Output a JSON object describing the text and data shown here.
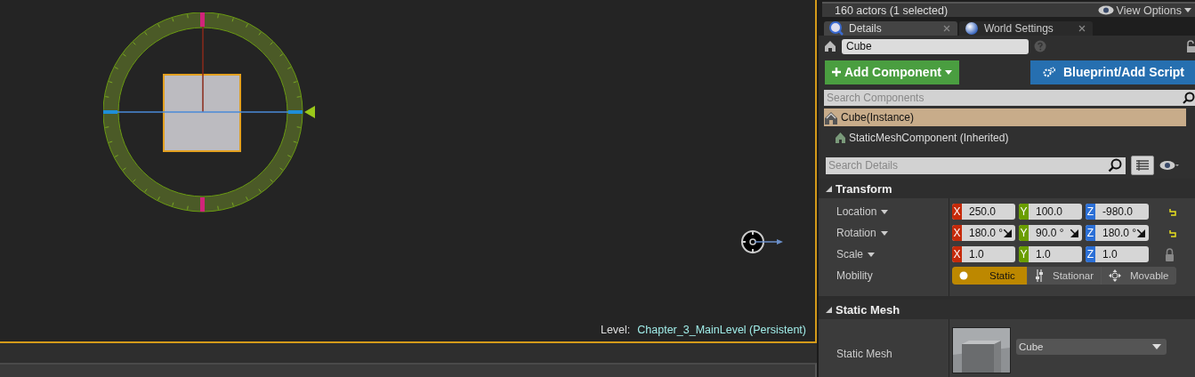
{
  "viewport": {
    "level_label": "Level:",
    "level_name": "Chapter_3_MainLevel (Persistent)"
  },
  "outliner": {
    "actor_count": "160 actors (1 selected)",
    "view_options": "View Options"
  },
  "tabs": [
    {
      "label": "Details",
      "selected": true,
      "kind": "details"
    },
    {
      "label": "World Settings",
      "selected": false,
      "kind": "world"
    }
  ],
  "actor_name": "Cube",
  "add_component": "Add Component",
  "blueprint": "Blueprint/Add Script",
  "component_search": {
    "placeholder": "Search Components"
  },
  "components": [
    {
      "label": "Cube(Instance)",
      "selected": true,
      "children": [
        {
          "label": "StaticMeshComponent (Inherited)",
          "selected": false
        }
      ]
    }
  ],
  "details_search": {
    "placeholder": "Search Details"
  },
  "sections": [
    {
      "title": "Transform",
      "expanded": true,
      "rows": [
        {
          "label": "Location",
          "kind": "vector",
          "dropdown": true,
          "reset": true,
          "values": [
            {
              "axis": "X",
              "value": "250.0"
            },
            {
              "axis": "Y",
              "value": "100.0"
            },
            {
              "axis": "Z",
              "value": "-980.0"
            }
          ]
        },
        {
          "label": "Rotation",
          "kind": "vector",
          "dropdown": true,
          "reset": true,
          "spin": true,
          "values": [
            {
              "axis": "X",
              "value": "180.0 °"
            },
            {
              "axis": "Y",
              "value": "90.0 °"
            },
            {
              "axis": "Z",
              "value": "180.0 °"
            }
          ]
        },
        {
          "label": "Scale",
          "kind": "vector",
          "dropdown": true,
          "lock": true,
          "values": [
            {
              "axis": "X",
              "value": "1.0"
            },
            {
              "axis": "Y",
              "value": "1.0"
            },
            {
              "axis": "Z",
              "value": "1.0"
            }
          ]
        },
        {
          "label": "Mobility",
          "kind": "mobility",
          "dropdown": false,
          "options": [
            {
              "label": "Static",
              "selected": true
            },
            {
              "label": "Stationar",
              "selected": false
            },
            {
              "label": "Movable",
              "selected": false
            }
          ]
        }
      ]
    },
    {
      "title": "Static Mesh",
      "expanded": true,
      "rows": [
        {
          "label": "Static Mesh",
          "kind": "asset",
          "dropdown": false,
          "value": "Cube"
        }
      ]
    }
  ]
}
